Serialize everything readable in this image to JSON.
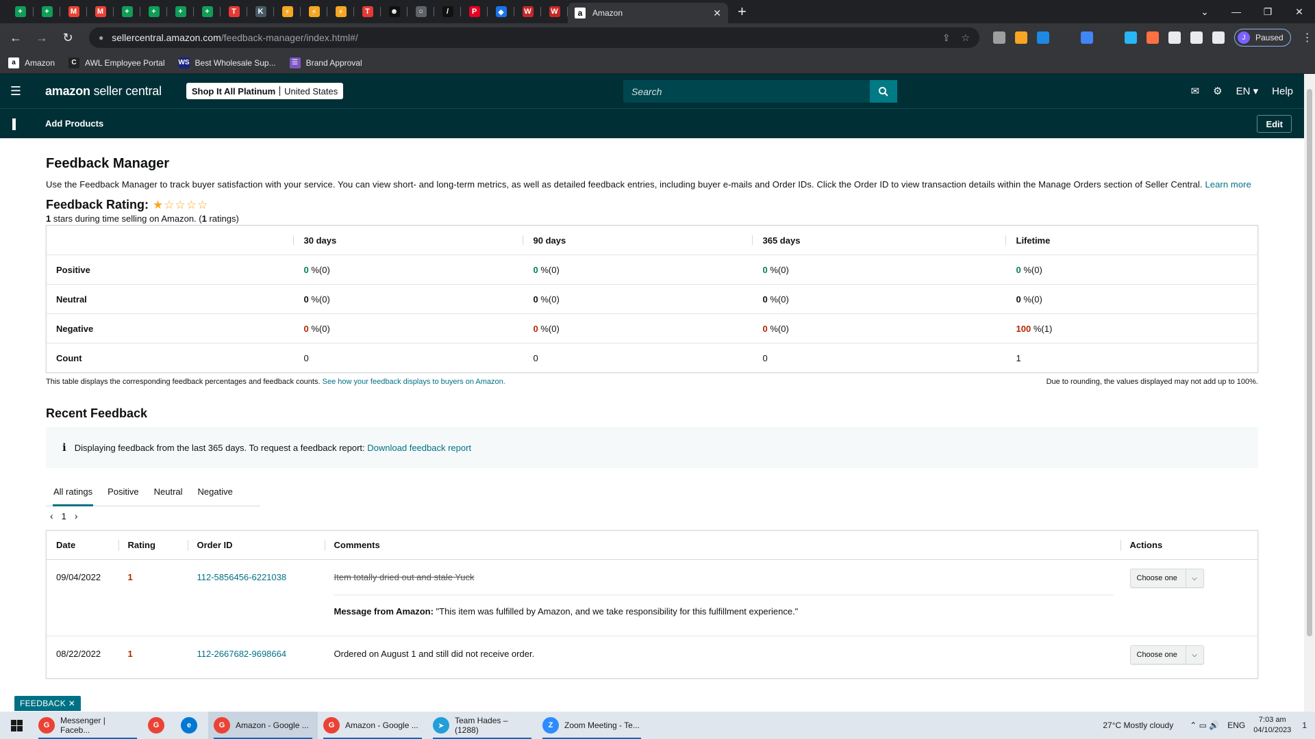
{
  "browser": {
    "tab_favicons": [
      {
        "name": "sheets-icon-1",
        "color": "#0f9d58",
        "glyph": "+"
      },
      {
        "name": "sheets-icon-2",
        "color": "#0f9d58",
        "glyph": "+"
      },
      {
        "name": "gmail-icon-1",
        "color": "#ea4335",
        "glyph": "M"
      },
      {
        "name": "gmail-icon-2",
        "color": "#ea4335",
        "glyph": "M"
      },
      {
        "name": "sheets-icon-3",
        "color": "#0f9d58",
        "glyph": "+"
      },
      {
        "name": "sheets-icon-4",
        "color": "#0f9d58",
        "glyph": "+"
      },
      {
        "name": "sheets-icon-5",
        "color": "#0f9d58",
        "glyph": "+"
      },
      {
        "name": "sheets-icon-6",
        "color": "#0f9d58",
        "glyph": "+"
      },
      {
        "name": "tool-icon-1",
        "color": "#e53935",
        "glyph": "T"
      },
      {
        "name": "tool-icon-2",
        "color": "#455a64",
        "glyph": "K"
      },
      {
        "name": "bolt-icon-1",
        "color": "#f5a623",
        "glyph": "⚡"
      },
      {
        "name": "bolt-icon-2",
        "color": "#f5a623",
        "glyph": "⚡"
      },
      {
        "name": "bolt-icon-3",
        "color": "#f5a623",
        "glyph": "⚡"
      },
      {
        "name": "tool-icon-3",
        "color": "#e53935",
        "glyph": "T"
      },
      {
        "name": "ghost-icon",
        "color": "#111111",
        "glyph": "☻"
      },
      {
        "name": "circle-icon",
        "color": "#5f6368",
        "glyph": "○"
      },
      {
        "name": "slash-icon",
        "color": "#111111",
        "glyph": "/"
      },
      {
        "name": "pinterest-icon",
        "color": "#e60023",
        "glyph": "P"
      },
      {
        "name": "diamond-icon",
        "color": "#1a73e8",
        "glyph": "◆"
      },
      {
        "name": "ww-icon-1",
        "color": "#c62828",
        "glyph": "W"
      },
      {
        "name": "ww-icon-2",
        "color": "#c62828",
        "glyph": "W"
      }
    ],
    "active_tab": {
      "favicon": "a",
      "title": "Amazon",
      "close": "✕"
    },
    "new_tab": "+",
    "window_controls": {
      "chevron": "⌄",
      "minimize": "—",
      "restore": "❐",
      "close": "✕"
    },
    "nav": {
      "back": "←",
      "forward": "→",
      "reload": "↻"
    },
    "url": {
      "host": "sellercentral.amazon.com",
      "path": "/feedback-manager/index.html#/"
    },
    "omnibox_icons": {
      "share": "⇪",
      "star": "☆"
    },
    "extensions": [
      {
        "name": "ext-off-icon",
        "color": "#9e9e9e"
      },
      {
        "name": "ext-js-icon",
        "color": "#f5a623"
      },
      {
        "name": "ext-ok-icon",
        "color": "#1e88e5"
      },
      {
        "name": "ext-arrow-icon",
        "color": "#35363a"
      },
      {
        "name": "ext-blue-icon",
        "color": "#4285f4"
      },
      {
        "name": "ext-r-icon",
        "color": "#35363a"
      },
      {
        "name": "ext-fm-icon",
        "color": "#29b6f6"
      },
      {
        "name": "ext-orange-icon",
        "color": "#ff7043"
      },
      {
        "name": "ext-grid-icon",
        "color": "#e8eaed"
      },
      {
        "name": "ext-puzzle-icon",
        "color": "#e8eaed"
      },
      {
        "name": "ext-sidepanel-icon",
        "color": "#e8eaed"
      }
    ],
    "profile": {
      "initial": "J",
      "status": "Paused"
    },
    "menu_icon": "⋮",
    "bookmarks": [
      {
        "label": "Amazon",
        "glyph": "a",
        "color": "#ffffff",
        "fg": "#000000"
      },
      {
        "label": "AWL Employee Portal",
        "glyph": "C",
        "color": "#222222",
        "fg": "#ffffff"
      },
      {
        "label": "Best Wholesale Sup...",
        "glyph": "WS",
        "color": "#1a237e",
        "fg": "#ffffff"
      },
      {
        "label": "Brand Approval",
        "glyph": "☰",
        "color": "#7e57c2",
        "fg": "#ffffff"
      }
    ]
  },
  "header": {
    "menu_icon": "☰",
    "logo_bold": "amazon",
    "logo_rest": " seller central",
    "store_name": "Shop It All Platinum",
    "marketplace": "United States",
    "search_placeholder": "Search",
    "language": "EN ▾",
    "help": "Help",
    "mail_icon": "✉",
    "gear_icon": "⚙",
    "search_icon": "⌕"
  },
  "subnav": {
    "bookmark_icon": "▌",
    "add_products": "Add Products",
    "edit": "Edit"
  },
  "page": {
    "title": "Feedback Manager",
    "intro": "Use the Feedback Manager to track buyer satisfaction with your service. You can view short- and long-term metrics, as well as detailed feedback entries, including buyer e-mails and Order IDs. Click the Order ID to view transaction details within the Manage Orders section of Seller Central.",
    "learn_more": "Learn more",
    "rating_label": "Feedback Rating:",
    "stars": "★☆☆☆☆",
    "rating_value": "1",
    "rating_text_a": " stars during time selling on Amazon. (",
    "rating_count": "1",
    "rating_text_b": " ratings)"
  },
  "metrics": {
    "columns": [
      "30 days",
      "90 days",
      "365 days",
      "Lifetime"
    ],
    "rows": [
      {
        "label": "Positive",
        "tone": "g",
        "values": [
          {
            "n": "0",
            "s": "%(0)"
          },
          {
            "n": "0",
            "s": "%(0)"
          },
          {
            "n": "0",
            "s": "%(0)"
          },
          {
            "n": "0",
            "s": "%(0)"
          }
        ]
      },
      {
        "label": "Neutral",
        "tone": "n",
        "values": [
          {
            "n": "0",
            "s": "%(0)"
          },
          {
            "n": "0",
            "s": "%(0)"
          },
          {
            "n": "0",
            "s": "%(0)"
          },
          {
            "n": "0",
            "s": "%(0)"
          }
        ]
      },
      {
        "label": "Negative",
        "tone": "r",
        "values": [
          {
            "n": "0",
            "s": "%(0)"
          },
          {
            "n": "0",
            "s": "%(0)"
          },
          {
            "n": "0",
            "s": "%(0)"
          },
          {
            "n": "100",
            "s": "%(1)"
          }
        ]
      }
    ],
    "count_label": "Count",
    "counts": [
      "0",
      "0",
      "0",
      "1"
    ],
    "foot_left": "This table displays the corresponding feedback percentages and feedback counts.",
    "foot_link": "See how your feedback displays to buyers on Amazon.",
    "foot_right": "Due to rounding, the values displayed may not add up to 100%."
  },
  "recent": {
    "title": "Recent Feedback",
    "info_icon": "i",
    "info_text": "Displaying feedback from the last 365 days. To request a feedback report:",
    "info_link": "Download feedback report",
    "tabs": [
      "All ratings",
      "Positive",
      "Neutral",
      "Negative"
    ],
    "page": "1",
    "prev": "‹",
    "next": "›",
    "headers": {
      "date": "Date",
      "rating": "Rating",
      "order": "Order ID",
      "comments": "Comments",
      "actions": "Actions"
    },
    "rows": [
      {
        "date": "09/04/2022",
        "rating": "1",
        "order_id": "112-5856456-6221038",
        "comment": "Item totally dried out and stale Yuck",
        "message_label": "Message from Amazon:",
        "message": " \"This item was fulfilled by Amazon, and we take responsibility for this fulfillment experience.\"",
        "action": "Choose one"
      },
      {
        "date": "08/22/2022",
        "rating": "1",
        "order_id": "112-2667682-9698664",
        "comment": "Ordered on August 1 and still did not receive order.",
        "action": "Choose one"
      }
    ]
  },
  "feedback_tab": "FEEDBACK ✕",
  "taskbar": {
    "items": [
      {
        "label": "Messenger | Faceb...",
        "color": "#ea4335",
        "glyph": "G",
        "state": "open"
      },
      {
        "label": "",
        "color": "#ea4335",
        "glyph": "G",
        "state": "pinned"
      },
      {
        "label": "",
        "color": "#0078d4",
        "glyph": "e",
        "state": "pinned"
      },
      {
        "label": "Amazon - Google ...",
        "color": "#ea4335",
        "glyph": "G",
        "state": "active"
      },
      {
        "label": "Amazon - Google ...",
        "color": "#ea4335",
        "glyph": "G",
        "state": "open"
      },
      {
        "label": "Team Hades – (1288)",
        "color": "#229ed9",
        "glyph": "➤",
        "state": "open"
      },
      {
        "label": "Zoom Meeting - Te...",
        "color": "#2d8cff",
        "glyph": "Z",
        "state": "open"
      }
    ],
    "weather": "27°C  Mostly cloudy",
    "tray_icons": "⌃  ▭  🔊",
    "lang": "ENG",
    "time": "7:03 am",
    "date": "04/10/2023",
    "notif": "1"
  }
}
